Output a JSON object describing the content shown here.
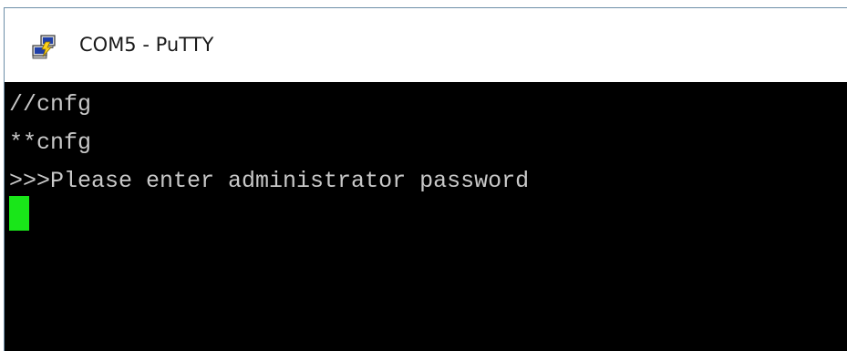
{
  "window": {
    "title": "COM5 - PuTTY",
    "app_icon": "putty-icon"
  },
  "terminal": {
    "lines": [
      "//cnfg",
      "**cnfg",
      ">>>Please enter administrator password"
    ],
    "cursor_color": "#19e619",
    "text_color": "#c8c8c8",
    "background": "#000000"
  }
}
